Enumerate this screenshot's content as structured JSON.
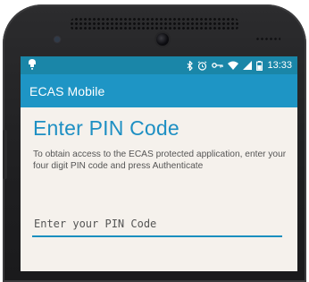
{
  "status_bar": {
    "time": "13:33",
    "icons": [
      "notification-icon",
      "bluetooth-icon",
      "alarm-icon",
      "vpn-key-icon",
      "wifi-icon",
      "cellular-signal-icon",
      "battery-icon"
    ]
  },
  "app_bar": {
    "title": "ECAS Mobile"
  },
  "main": {
    "heading": "Enter PIN Code",
    "instructions": "To obtain access to the ECAS protected application, enter your four digit PIN code and press Authenticate",
    "pin_field": {
      "placeholder": "Enter your PIN Code",
      "value": ""
    }
  },
  "colors": {
    "status_bar": "#1a86a8",
    "app_bar": "#1e95c5",
    "accent": "#1d8fc3",
    "screen_bg": "#f5f1ec"
  }
}
